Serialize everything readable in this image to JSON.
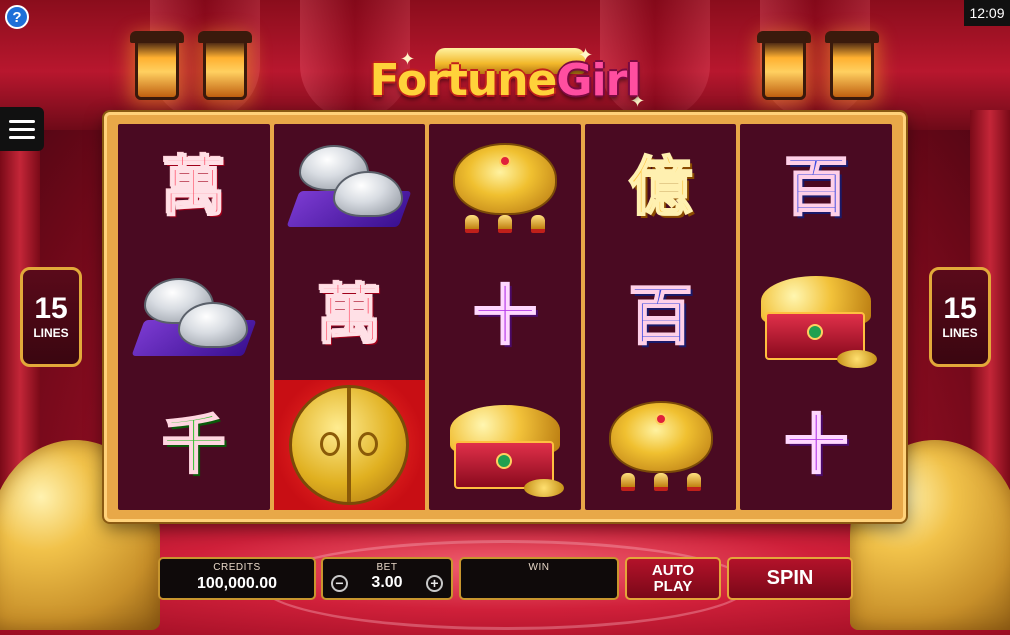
{
  "game": {
    "title_part1": "Fortune",
    "title_part2": "Girl"
  },
  "status": {
    "clock": "12:09",
    "help_icon": "?"
  },
  "lines": {
    "left_count": "15",
    "left_label": "LINES",
    "right_count": "15",
    "right_label": "LINES"
  },
  "reels": [
    [
      "萬",
      "silver-ingot",
      "千"
    ],
    [
      "silver-ingot",
      "萬",
      "gold-door"
    ],
    [
      "gold-lock",
      "十",
      "treasure-chest"
    ],
    [
      "億",
      "百",
      "gold-lock"
    ],
    [
      "百",
      "treasure-chest",
      "十"
    ]
  ],
  "symbols": {
    "wan": "萬",
    "yi": "億",
    "bai": "百",
    "shi": "十",
    "qian": "千"
  },
  "controls": {
    "credits_label": "CREDITS",
    "credits_value": "100,000.00",
    "bet_label": "BET",
    "bet_value": "3.00",
    "bet_minus": "−",
    "bet_plus": "+",
    "win_label": "WIN",
    "win_value": "",
    "autoplay_line1": "AUTO",
    "autoplay_line2": "PLAY",
    "spin_label": "SPIN"
  },
  "colors": {
    "frame_gold": "#e8a848",
    "reel_bg": "#4a0a22",
    "button_red": "#b3122a",
    "help_blue": "#1d6fd8"
  }
}
